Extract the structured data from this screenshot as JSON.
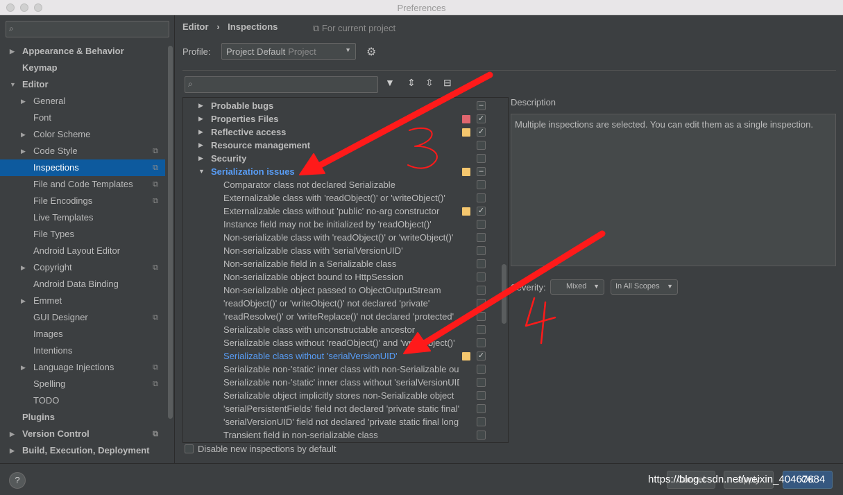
{
  "window": {
    "title": "Preferences"
  },
  "sidebar": {
    "items": [
      {
        "label": "Appearance & Behavior",
        "level": 0,
        "bold": true,
        "arrow": "right"
      },
      {
        "label": "Keymap",
        "level": 0,
        "bold": true
      },
      {
        "label": "Editor",
        "level": 0,
        "bold": true,
        "arrow": "down"
      },
      {
        "label": "General",
        "level": 1,
        "arrow": "right"
      },
      {
        "label": "Font",
        "level": 1
      },
      {
        "label": "Color Scheme",
        "level": 1,
        "arrow": "right"
      },
      {
        "label": "Code Style",
        "level": 1,
        "arrow": "right",
        "copy": true
      },
      {
        "label": "Inspections",
        "level": 1,
        "selected": true,
        "copy": true
      },
      {
        "label": "File and Code Templates",
        "level": 1,
        "copy": true
      },
      {
        "label": "File Encodings",
        "level": 1,
        "copy": true
      },
      {
        "label": "Live Templates",
        "level": 1
      },
      {
        "label": "File Types",
        "level": 1
      },
      {
        "label": "Android Layout Editor",
        "level": 1
      },
      {
        "label": "Copyright",
        "level": 1,
        "arrow": "right",
        "copy": true
      },
      {
        "label": "Android Data Binding",
        "level": 1
      },
      {
        "label": "Emmet",
        "level": 1,
        "arrow": "right"
      },
      {
        "label": "GUI Designer",
        "level": 1,
        "copy": true
      },
      {
        "label": "Images",
        "level": 1
      },
      {
        "label": "Intentions",
        "level": 1
      },
      {
        "label": "Language Injections",
        "level": 1,
        "arrow": "right",
        "copy": true
      },
      {
        "label": "Spelling",
        "level": 1,
        "copy": true
      },
      {
        "label": "TODO",
        "level": 1
      },
      {
        "label": "Plugins",
        "level": 0,
        "bold": true
      },
      {
        "label": "Version Control",
        "level": 0,
        "bold": true,
        "arrow": "right",
        "copy": true
      },
      {
        "label": "Build, Execution, Deployment",
        "level": 0,
        "bold": true,
        "arrow": "right"
      }
    ]
  },
  "header": {
    "breadcrumb": [
      "Editor",
      "›",
      "Inspections"
    ],
    "for_current_project": "For current project",
    "profile_label": "Profile:",
    "profile_value": "Project Default",
    "profile_scope": "Project"
  },
  "tree": {
    "rows": [
      {
        "label": "Probable bugs",
        "type": "cat",
        "expanded": false,
        "check": "mixed"
      },
      {
        "label": "Properties Files",
        "type": "cat",
        "expanded": false,
        "severity": "#e0666e",
        "check": "checked"
      },
      {
        "label": "Reflective access",
        "type": "cat",
        "expanded": false,
        "severity": "#f5c76e",
        "check": "checked"
      },
      {
        "label": "Resource management",
        "type": "cat",
        "expanded": false,
        "check": "unchecked"
      },
      {
        "label": "Security",
        "type": "cat",
        "expanded": false,
        "check": "unchecked"
      },
      {
        "label": "Serialization issues",
        "type": "cat",
        "expanded": true,
        "highlight": true,
        "severity": "#f5c76e",
        "check": "mixed"
      },
      {
        "label": "Comparator class not declared Serializable",
        "type": "item",
        "check": "unchecked"
      },
      {
        "label": "Externalizable class with 'readObject()' or 'writeObject()'",
        "type": "item",
        "check": "unchecked"
      },
      {
        "label": "Externalizable class without 'public' no-arg constructor",
        "type": "item",
        "severity": "#f5c76e",
        "check": "checked"
      },
      {
        "label": "Instance field may not be initialized by 'readObject()'",
        "type": "item",
        "check": "unchecked"
      },
      {
        "label": "Non-serializable class with 'readObject()' or 'writeObject()'",
        "type": "item",
        "check": "unchecked"
      },
      {
        "label": "Non-serializable class with 'serialVersionUID'",
        "type": "item",
        "check": "unchecked"
      },
      {
        "label": "Non-serializable field in a Serializable class",
        "type": "item",
        "check": "unchecked"
      },
      {
        "label": "Non-serializable object bound to HttpSession",
        "type": "item",
        "check": "unchecked"
      },
      {
        "label": "Non-serializable object passed to ObjectOutputStream",
        "type": "item",
        "check": "unchecked"
      },
      {
        "label": "'readObject()' or 'writeObject()' not declared 'private'",
        "type": "item",
        "check": "unchecked"
      },
      {
        "label": "'readResolve()' or 'writeReplace()' not declared 'protected'",
        "type": "item",
        "check": "unchecked"
      },
      {
        "label": "Serializable class with unconstructable ancestor",
        "type": "item",
        "check": "unchecked"
      },
      {
        "label": "Serializable class without 'readObject()' and 'writeObject()'",
        "type": "item",
        "check": "unchecked"
      },
      {
        "label": "Serializable class without 'serialVersionUID'",
        "type": "item",
        "highlight": true,
        "severity": "#f5c76e",
        "check": "checked"
      },
      {
        "label": "Serializable non-'static' inner class with non-Serializable outer class",
        "type": "item",
        "check": "unchecked"
      },
      {
        "label": "Serializable non-'static' inner class without 'serialVersionUID'",
        "type": "item",
        "check": "unchecked"
      },
      {
        "label": "Serializable object implicitly stores non-Serializable object",
        "type": "item",
        "check": "unchecked"
      },
      {
        "label": "'serialPersistentFields' field not declared 'private static final'",
        "type": "item",
        "check": "unchecked"
      },
      {
        "label": "'serialVersionUID' field not declared 'private static final long'",
        "type": "item",
        "check": "unchecked"
      },
      {
        "label": "Transient field in non-serializable class",
        "type": "item",
        "check": "unchecked"
      }
    ]
  },
  "description": {
    "label": "Description",
    "text": "Multiple inspections are selected. You can edit them as a single inspection."
  },
  "severity": {
    "label": "Severity:",
    "value": "Mixed",
    "scope": "In All Scopes"
  },
  "options": {
    "disable_new": "Disable new inspections by default"
  },
  "footer": {
    "help": "?",
    "cancel": "Cancel",
    "apply": "Apply",
    "ok": "OK",
    "watermark": "https://blog.csdn.net/weixin_40467684"
  },
  "annotations": {
    "mark_3": "3",
    "mark_4": "4",
    "color": "#ff1a1a"
  },
  "colors": {
    "selected": "#0d5a9e",
    "accent": "#589df6",
    "warning": "#f5c76e",
    "error": "#e0666e"
  }
}
